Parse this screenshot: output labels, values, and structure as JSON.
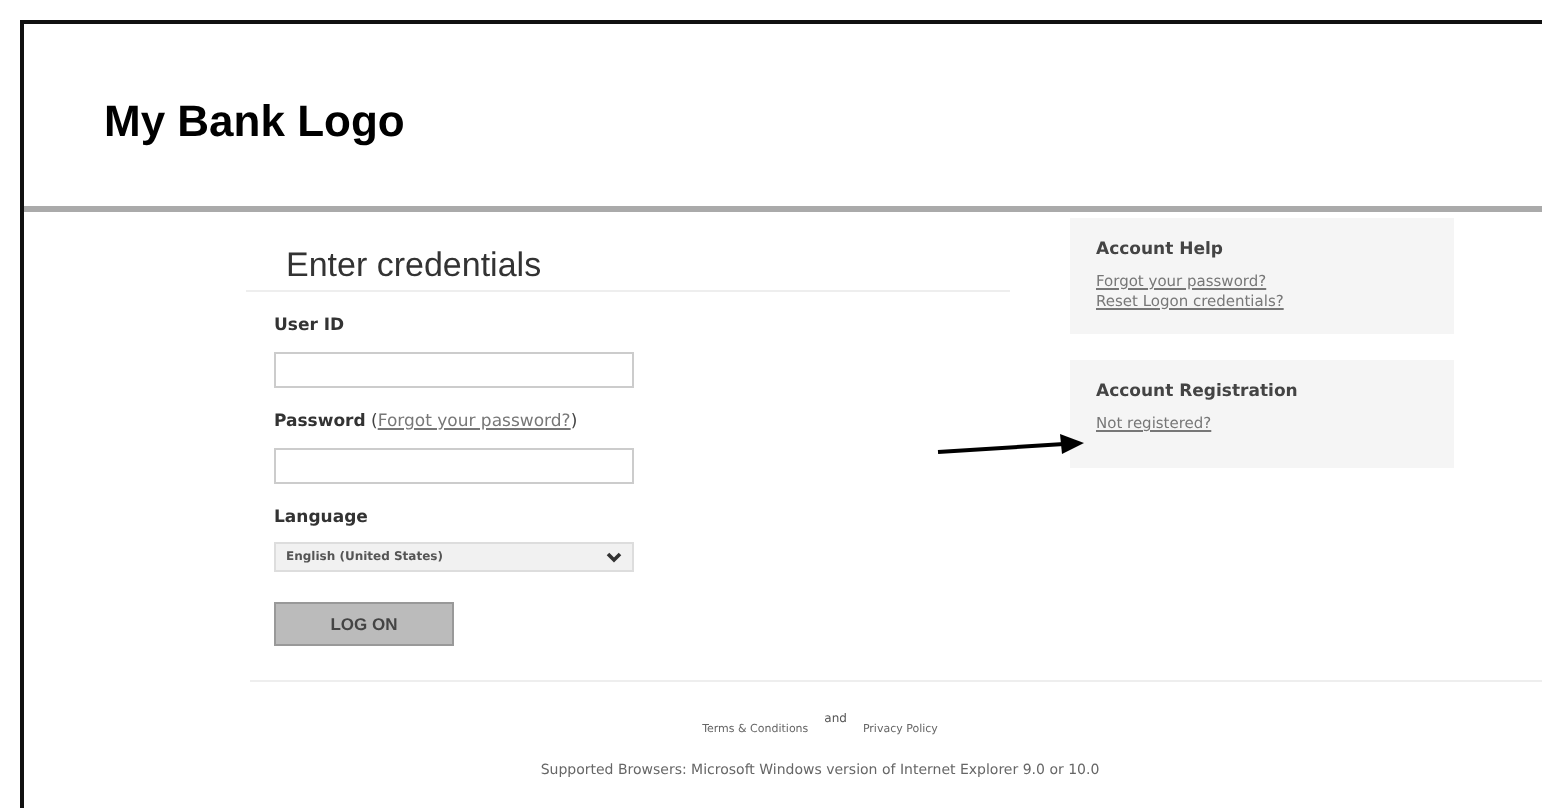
{
  "header": {
    "logo": "My Bank Logo"
  },
  "form": {
    "title": "Enter credentials",
    "fields": [
      {
        "kind": "text",
        "label": "User ID"
      },
      {
        "kind": "password",
        "label": "Password",
        "link_open": "(",
        "link": "Forgot your password?",
        "link_close": ")"
      },
      {
        "kind": "select",
        "label": "Language",
        "value": "English (United States)"
      }
    ],
    "button": "LOG ON"
  },
  "panels": [
    {
      "title": "Account Help",
      "links": [
        "Forgot your password?",
        "Reset Logon credentials?"
      ]
    },
    {
      "title": "Account Registration",
      "links": [
        "Not registered?"
      ]
    }
  ],
  "footer": {
    "links": [
      {
        "kind": "link",
        "text": "Terms & Conditions"
      },
      {
        "kind": "raised",
        "text": "and"
      },
      {
        "kind": "link",
        "text": "Privacy Policy"
      }
    ],
    "note": "Supported Browsers: Microsoft Windows version of Internet Explorer 9.0 or 10.0"
  }
}
